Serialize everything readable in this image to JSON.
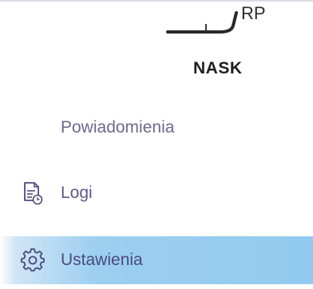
{
  "branding": {
    "logo_top_text": "RP",
    "logo_bottom_text": "NASK"
  },
  "sidebar": {
    "items": [
      {
        "label": "Powiadomienia",
        "icon": "bell-icon",
        "active": false
      },
      {
        "label": "Logi",
        "icon": "log-file-icon",
        "active": false
      },
      {
        "label": "Ustawienia",
        "icon": "gear-icon",
        "active": true
      }
    ]
  },
  "colors": {
    "active_background": "#92caef",
    "label_color": "#5a5a8a",
    "icon_color": "#4b4b7a"
  }
}
